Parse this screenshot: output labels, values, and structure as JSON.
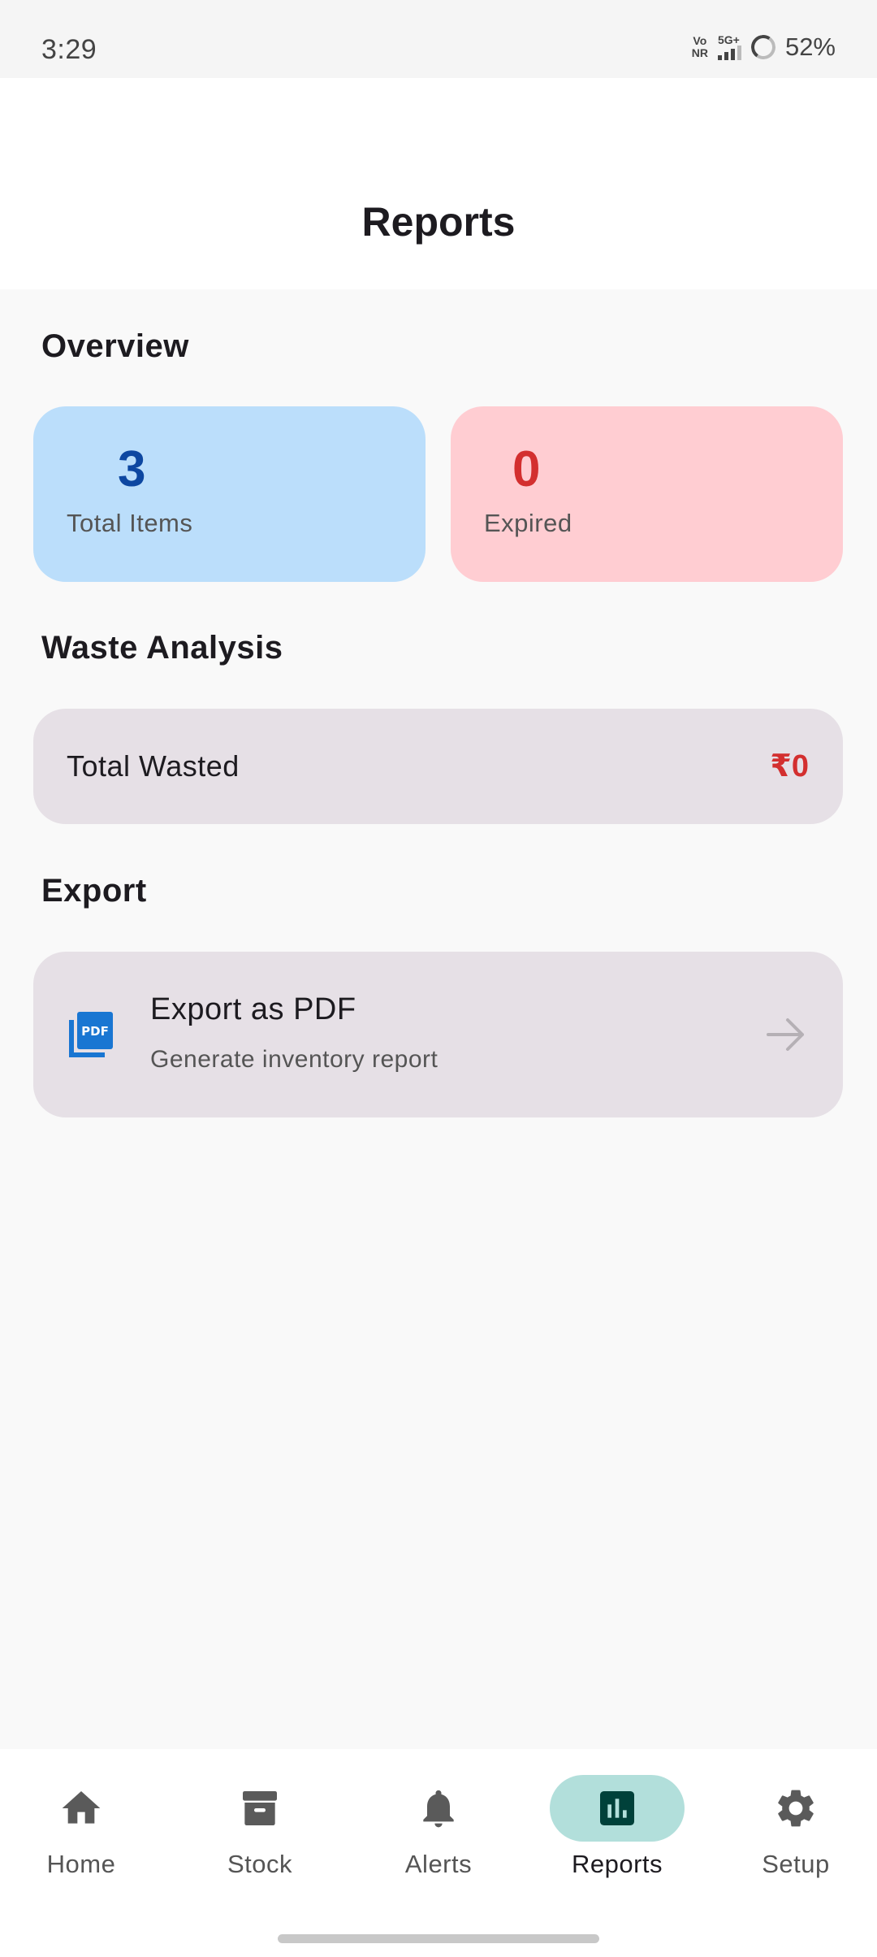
{
  "status_bar": {
    "time": "3:29",
    "volte_top": "Vo",
    "volte_bottom": "NR",
    "network": "5G+",
    "battery": "52%"
  },
  "app_bar": {
    "title": "Reports"
  },
  "overview": {
    "heading": "Overview",
    "total_items": {
      "value": "3",
      "label": "Total Items",
      "color": "#0d47a1"
    },
    "expired": {
      "value": "0",
      "label": "Expired",
      "color": "#d32f2f"
    }
  },
  "waste": {
    "heading": "Waste Analysis",
    "label": "Total Wasted",
    "value": "₹0"
  },
  "export": {
    "heading": "Export",
    "title": "Export as PDF",
    "subtitle": "Generate inventory report",
    "icon": "pdf-icon",
    "pdf_badge": "PDF"
  },
  "nav": {
    "items": [
      {
        "label": "Home",
        "icon": "home-icon"
      },
      {
        "label": "Stock",
        "icon": "archive-icon"
      },
      {
        "label": "Alerts",
        "icon": "bell-icon"
      },
      {
        "label": "Reports",
        "icon": "bar-chart-icon",
        "active": true
      },
      {
        "label": "Setup",
        "icon": "gear-icon"
      }
    ],
    "active_color": "#b2dfdb"
  }
}
